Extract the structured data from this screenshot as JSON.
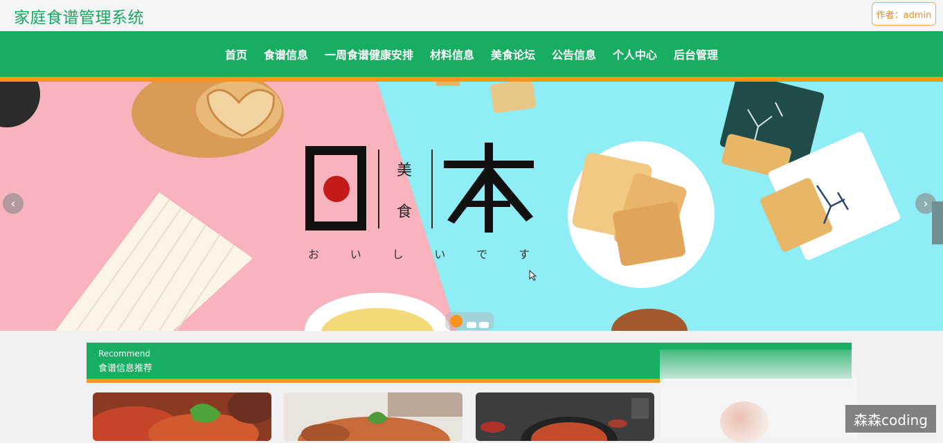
{
  "header": {
    "site_title": "家庭食谱管理系统",
    "author_label": "作者：admin"
  },
  "nav": {
    "items": [
      "首页",
      "食谱信息",
      "一周食谱健康安排",
      "材料信息",
      "美食论坛",
      "公告信息",
      "个人中心",
      "后台管理"
    ]
  },
  "banner": {
    "big_char_left": "日",
    "small_chars": [
      "美",
      "食"
    ],
    "big_char_right": "本",
    "kana": [
      "お",
      "い",
      "し",
      "い",
      "で",
      "す"
    ],
    "prev_icon": "chevron-left-icon",
    "next_icon": "chevron-right-icon",
    "slide_count": 3,
    "active_slide": 1
  },
  "recommend": {
    "title_en": "Recommend",
    "title_cn": "食谱信息推荐"
  },
  "watermark": "森森coding",
  "colors": {
    "brand_green": "#17ae62",
    "accent_orange": "#f7931e",
    "banner_pink": "#f9b3bd",
    "banner_cyan": "#8eedf5"
  }
}
